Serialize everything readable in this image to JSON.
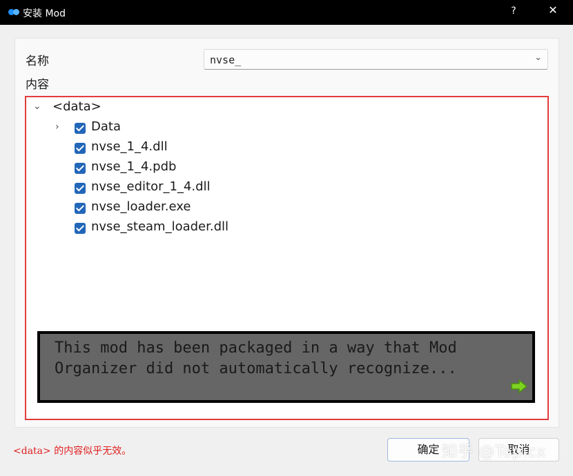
{
  "window": {
    "title": "安装 Mod",
    "help_glyph": "?",
    "close_glyph": "✕",
    "app_icon": "mod-organizer-icon"
  },
  "form": {
    "name_label": "名称",
    "name_value": "nvse_",
    "content_label": "内容"
  },
  "tree": {
    "root": {
      "label": "<data>",
      "expanded": true
    },
    "items": [
      {
        "label": "Data",
        "checked": true,
        "expandable": true
      },
      {
        "label": "nvse_1_4.dll",
        "checked": true
      },
      {
        "label": "nvse_1_4.pdb",
        "checked": true
      },
      {
        "label": "nvse_editor_1_4.dll",
        "checked": true
      },
      {
        "label": "nvse_loader.exe",
        "checked": true
      },
      {
        "label": "nvse_steam_loader.dll",
        "checked": true
      }
    ]
  },
  "overlay": {
    "text": "This mod has been packaged in a way that Mod Organizer did not automatically recognize...",
    "icon": "green-arrow-icon"
  },
  "status": {
    "text": "<data> 的内容似乎无效。",
    "color": "#e02020"
  },
  "buttons": {
    "ok": "确定",
    "cancel": "取消"
  },
  "watermark": "知乎 @Topicx",
  "colors": {
    "tree_border": "#e23b3b",
    "checkbox": "#2266b8",
    "title_bar": "#000000"
  }
}
